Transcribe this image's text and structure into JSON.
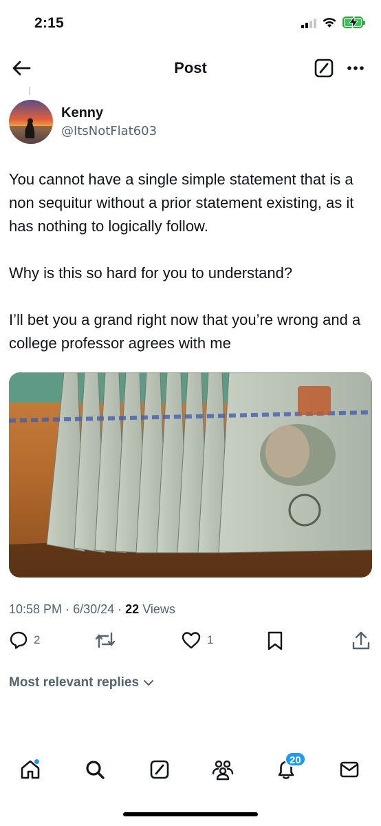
{
  "status_bar": {
    "time": "2:15",
    "signal_icon": "cellular-signal-icon",
    "wifi_icon": "wifi-icon",
    "battery_icon": "battery-charging-icon",
    "battery_color": "#34c759"
  },
  "header": {
    "title": "Post",
    "back_icon": "arrow-left-icon",
    "compose_icon": "compose-icon",
    "more_icon": "more-horizontal-icon"
  },
  "author": {
    "name": "Kenny",
    "handle": "@ItsNotFlat603"
  },
  "tweet": {
    "paragraphs": [
      "You cannot have a single simple statement that is a non sequitur without a prior statement existing, as it has nothing to logically follow.",
      "Why is this so hard for you to understand?",
      "I’ll bet you a grand right now that you’re wrong and a college professor agrees with me"
    ],
    "time": "10:58 PM",
    "date": "6/30/24",
    "separator": "·",
    "views_count": "22",
    "views_label": "Views"
  },
  "actions": {
    "replies": {
      "icon": "reply-icon",
      "count": "2"
    },
    "reposts": {
      "icon": "repost-icon",
      "count": ""
    },
    "likes": {
      "icon": "heart-icon",
      "count": "1"
    },
    "bookmark": {
      "icon": "bookmark-icon"
    },
    "share": {
      "icon": "share-icon"
    }
  },
  "replies_filter": {
    "label": "Most relevant replies",
    "icon": "chevron-down-icon"
  },
  "tabbar": {
    "home": {
      "icon": "home-icon"
    },
    "search": {
      "icon": "search-icon"
    },
    "compose": {
      "icon": "compose-icon"
    },
    "communities": {
      "icon": "communities-icon"
    },
    "notifications": {
      "icon": "bell-icon",
      "badge": "20"
    },
    "messages": {
      "icon": "mail-icon"
    }
  },
  "colors": {
    "text": "#0f1419",
    "secondary": "#536471",
    "accent": "#1d9bf0"
  }
}
